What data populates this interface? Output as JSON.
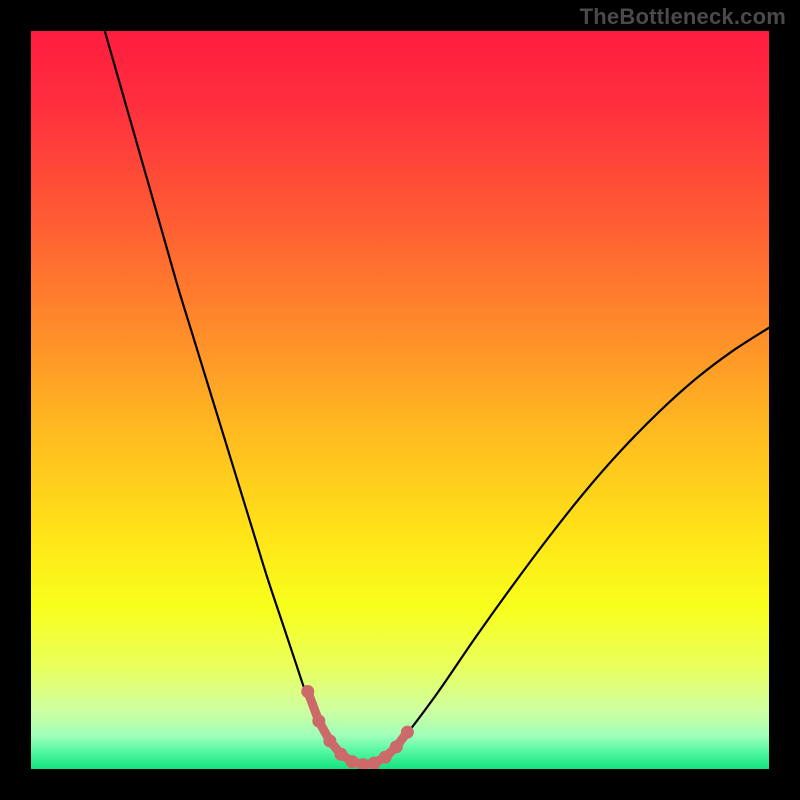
{
  "watermark": "TheBottleneck.com",
  "colors": {
    "frame_bg": "#000000",
    "gradient_stops": [
      {
        "offset": 0.0,
        "color": "#ff1d3f"
      },
      {
        "offset": 0.1,
        "color": "#ff2f3e"
      },
      {
        "offset": 0.25,
        "color": "#ff5a34"
      },
      {
        "offset": 0.4,
        "color": "#ff8a2a"
      },
      {
        "offset": 0.55,
        "color": "#ffbd20"
      },
      {
        "offset": 0.68,
        "color": "#ffe318"
      },
      {
        "offset": 0.78,
        "color": "#f8ff1c"
      },
      {
        "offset": 0.86,
        "color": "#eaff5c"
      },
      {
        "offset": 0.92,
        "color": "#cfffa0"
      },
      {
        "offset": 0.955,
        "color": "#9fffb9"
      },
      {
        "offset": 0.975,
        "color": "#58f8a3"
      },
      {
        "offset": 1.0,
        "color": "#12e37f"
      }
    ],
    "curve_stroke": "#000000",
    "marker_stroke": "#cc6a6a",
    "marker_fill": "#cc6a6a"
  },
  "chart_data": {
    "type": "line",
    "title": "",
    "xlabel": "",
    "ylabel": "",
    "xlim": [
      0,
      100
    ],
    "ylim": [
      0,
      100
    ],
    "note": "No visible axis ticks or labels. Curve values estimated from pixel positions. y=0 at bottom (green), y=100 at top (red).",
    "series": [
      {
        "name": "curve",
        "x": [
          10,
          12,
          14,
          16,
          18,
          20,
          22,
          24,
          26,
          28,
          30,
          32,
          34,
          35,
          36,
          37,
          38,
          39,
          40,
          41,
          42,
          43,
          44,
          45,
          46,
          47,
          48,
          50,
          55,
          60,
          65,
          70,
          75,
          80,
          85,
          90,
          95,
          100
        ],
        "y": [
          100,
          93,
          86,
          79,
          72,
          65,
          58.5,
          52,
          45.5,
          39,
          32.5,
          26,
          20,
          17,
          14,
          11,
          8.5,
          6.3,
          4.5,
          3.1,
          2.1,
          1.4,
          0.9,
          0.6,
          0.6,
          0.9,
          1.6,
          3.6,
          10.2,
          17.5,
          24.5,
          31.2,
          37.5,
          43.2,
          48.3,
          52.8,
          56.6,
          59.8
        ]
      }
    ],
    "markers": {
      "name": "bottom-segment",
      "x": [
        37.5,
        39.0,
        40.5,
        42.0,
        43.5,
        45.0,
        46.5,
        48.0,
        49.5,
        51.0
      ],
      "y": [
        10.5,
        6.5,
        3.8,
        2.0,
        1.0,
        0.6,
        0.8,
        1.6,
        3.0,
        5.0
      ]
    }
  }
}
